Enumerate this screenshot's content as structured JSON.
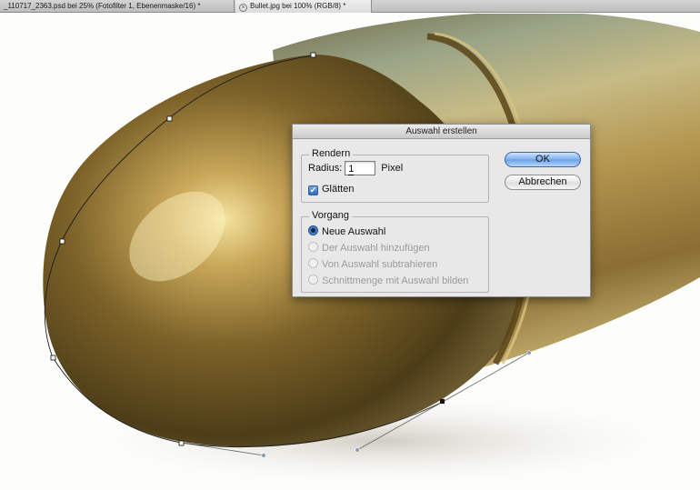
{
  "tabs": [
    {
      "label": "_110717_2363.psd bei 25% (Fotofilter 1, Ebenenmaske/16) *",
      "active": false
    },
    {
      "label": "Bullet.jpg bei 100% (RGB/8) *",
      "active": true
    }
  ],
  "canvas": {
    "image_subject": "brass bullet photo with path selection"
  },
  "dialog": {
    "title": "Auswahl erstellen",
    "render_group": {
      "legend": "Rendern",
      "radius_label": "Radius:",
      "radius_value": "1",
      "radius_unit": "Pixel",
      "smooth_label": "Glätten",
      "smooth_checked": true
    },
    "operation_group": {
      "legend": "Vorgang",
      "options": [
        {
          "label": "Neue Auswahl",
          "selected": true,
          "enabled": true
        },
        {
          "label": "Der Auswahl hinzufügen",
          "selected": false,
          "enabled": false
        },
        {
          "label": "Von Auswahl subtrahieren",
          "selected": false,
          "enabled": false
        },
        {
          "label": "Schnittmenge mit Auswahl bilden",
          "selected": false,
          "enabled": false
        }
      ]
    },
    "ok_label": "OK",
    "cancel_label": "Abbrechen"
  },
  "colors": {
    "brass_dark": "#5e4a1e",
    "brass_mid": "#a98f4e",
    "brass_light": "#e0cf8e",
    "patina": "#8e9a7d",
    "accent_blue": "#3c7dd0"
  }
}
